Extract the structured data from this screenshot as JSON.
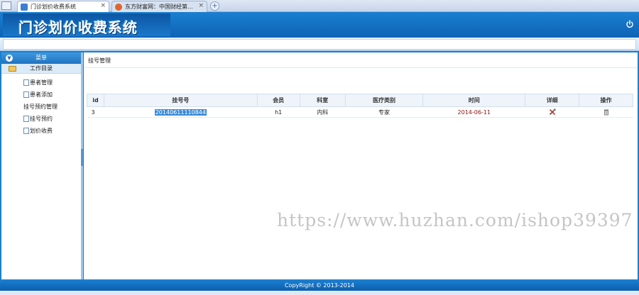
{
  "browser": {
    "tabs": [
      {
        "label": "门诊划价收费系统",
        "active": true
      },
      {
        "label": "东方财富网：中国财经第...",
        "active": false
      }
    ],
    "close_glyph": "×",
    "new_tab_glyph": "+"
  },
  "app": {
    "title": "门诊划价收费系统"
  },
  "sidebar": {
    "header": "菜单",
    "folder": "工作目录",
    "items": [
      {
        "label": "患者管理",
        "icon": "document-icon"
      },
      {
        "label": "患者添加",
        "icon": "document-icon"
      },
      {
        "label": "挂号预约管理",
        "icon": ""
      },
      {
        "label": "挂号预约",
        "icon": "document-icon"
      },
      {
        "label": "划价收费",
        "icon": "document-icon"
      }
    ]
  },
  "content": {
    "breadcrumb": "挂号管理",
    "table": {
      "headers": [
        "id",
        "挂号号",
        "会员",
        "科室",
        "医疗类别",
        "时间",
        "详细",
        "操作"
      ],
      "rows": [
        {
          "id": "3",
          "number": "20140611110844",
          "member": "h1",
          "dept": "内科",
          "type": "专家",
          "time": "2014-06-11",
          "detail_icon": "tools-icon",
          "action_icon": "trash-icon"
        }
      ]
    }
  },
  "watermark": "https://www.huzhan.com/ishop39397",
  "footer": "CopyRight © 2013-2014",
  "colors": {
    "header_blue": "#1a7fd0",
    "selection": "#3a8bd6",
    "date_text": "#8a1010"
  }
}
